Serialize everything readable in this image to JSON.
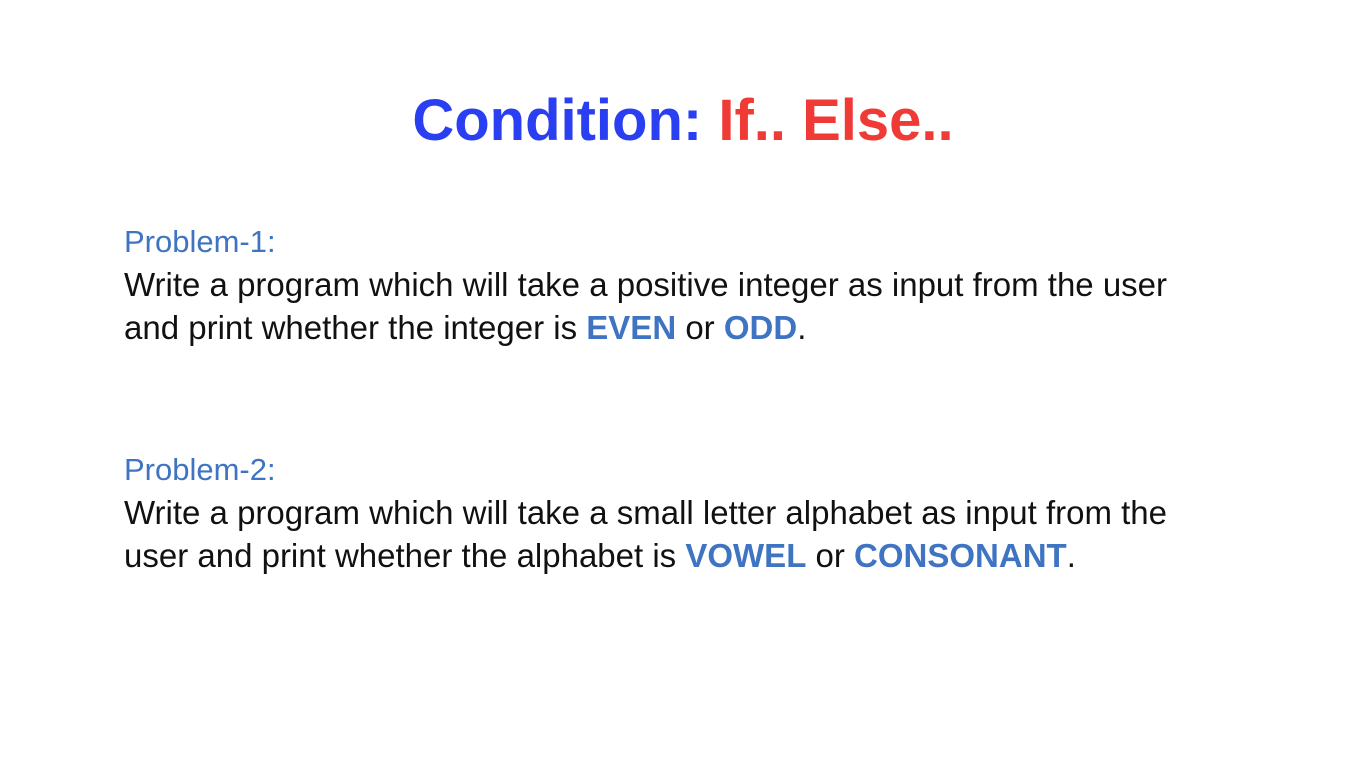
{
  "title": {
    "part1": "Condition: ",
    "part2": "If.. Else.."
  },
  "colors": {
    "title_blue": "#2a3ef2",
    "title_red": "#ef3a36",
    "accent_blue": "#3f74c3",
    "text": "#111111"
  },
  "problems": [
    {
      "label": "Problem-1:",
      "line1": "Write a program which will take a positive integer as input from the user",
      "line2_prefix": "and print whether the integer is ",
      "keyword1": "EVEN",
      "connector": " or ",
      "keyword2": "ODD",
      "suffix": "."
    },
    {
      "label": "Problem-2:",
      "line1": "Write a program which will take a small letter alphabet as input from the",
      "line2_prefix": "user and print whether the alphabet is ",
      "keyword1": "VOWEL",
      "connector": " or ",
      "keyword2": "CONSONANT",
      "suffix": "."
    }
  ]
}
